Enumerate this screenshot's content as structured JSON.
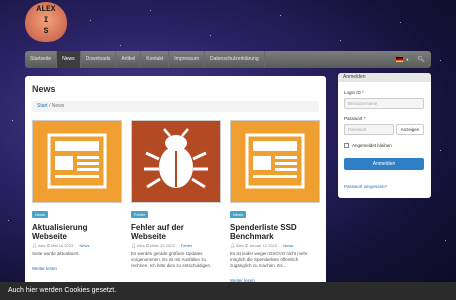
{
  "logo": {
    "lines": [
      "ALEX",
      "I",
      "S"
    ]
  },
  "navbar": {
    "items": [
      "Startseite",
      "News",
      "Downloads",
      "Artikel",
      "Kontakt",
      "Impressum",
      "Datenschutzerklärung"
    ],
    "active_index": 1
  },
  "main": {
    "title": "News",
    "breadcrumb": {
      "home": "Start",
      "current": "News"
    },
    "articles": [
      {
        "badge": "News",
        "title": "Aktualisierung Webseite",
        "meta_author": "Alex",
        "meta_date": "Mai 16 2023",
        "meta_category": "News",
        "excerpt": "Seite wurde aktualisiert.",
        "readmore": "Weiter lesen"
      },
      {
        "badge": "Fehler",
        "title": "Fehler auf der Webseite",
        "meta_author": "Alex",
        "meta_date": "März 29 2023",
        "meta_category": "Fehler",
        "excerpt": "Es werden gerade größere Updates vorgenommen. Es ist mit Ausfällen zu rechnen. Ich bitte dies zu entschuldigen.",
        "readmore": ""
      },
      {
        "badge": "News",
        "title": "Spenderliste SSD Benchmark",
        "meta_author": "Alex",
        "meta_date": "Januar 12 2023",
        "meta_category": "News",
        "excerpt": "Es ist leider wegen DSGVO nicht mehr möglich die Spenderliste öffentlich zugänglich zu machen. Es...",
        "readmore": "Weiter lesen"
      }
    ]
  },
  "sidebar": {
    "heading": "Anmelden",
    "login_label": "Login ID",
    "login_placeholder": "Benutzername",
    "password_label": "Passwort",
    "password_placeholder": "Passwort",
    "show_button": "Anzeigen",
    "remember_label": "Angemeldet bleiben",
    "login_button": "Anmelden",
    "forgot_link": "Passwort vergessen?"
  },
  "cookie": {
    "text": "Auch hier werden Cookies gesetzt."
  },
  "colors": {
    "accent": "#2f7fc6",
    "badge": "#4aa3c4",
    "thumb_orange": "#f0a030",
    "thumb_rust": "#b44a24"
  }
}
